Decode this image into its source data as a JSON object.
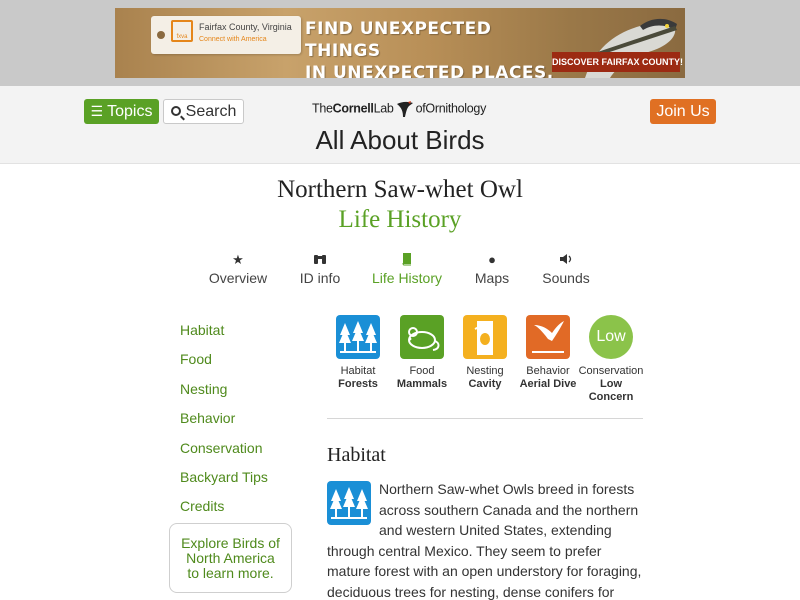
{
  "ad": {
    "tag_title": "Fairfax County, Virginia",
    "tag_subtitle": "Connect with America",
    "headline_1": "FIND UNEXPECTED THINGS",
    "headline_2": "IN UNEXPECTED PLACES.",
    "cta": "DISCOVER FAIRFAX COUNTY!",
    "logo_icon": "fairfax-logo-icon",
    "image_icon": "heron-image"
  },
  "header": {
    "topics_label": "Topics",
    "search_label": "Search",
    "join_label": "Join Us",
    "logo": {
      "the": "The",
      "cornell": "Cornell",
      "lab": "Lab",
      "of": "of",
      "ornithology": "Ornithology"
    },
    "site_title": "All About Birds"
  },
  "species": {
    "name": "Northern Saw-whet Owl",
    "section": "Life History"
  },
  "tabs": [
    {
      "label": "Overview",
      "icon": "star-icon"
    },
    {
      "label": "ID info",
      "icon": "binoculars-icon"
    },
    {
      "label": "Life History",
      "icon": "book-icon",
      "active": true
    },
    {
      "label": "Maps",
      "icon": "globe-icon"
    },
    {
      "label": "Sounds",
      "icon": "speaker-icon"
    }
  ],
  "sidebar": {
    "links": [
      "Habitat",
      "Food",
      "Nesting",
      "Behavior",
      "Conservation",
      "Backyard Tips",
      "Credits"
    ],
    "explore_1": "Explore Birds of",
    "explore_2": "North America",
    "explore_3": "to learn more."
  },
  "cards": [
    {
      "category": "Habitat",
      "value": "Forests",
      "icon": "forest-icon",
      "color": "#1a8fd6"
    },
    {
      "category": "Food",
      "value": "Mammals",
      "icon": "mouse-icon",
      "color": "#5aa125"
    },
    {
      "category": "Nesting",
      "value": "Cavity",
      "icon": "cavity-nest-icon",
      "color": "#f4b01f"
    },
    {
      "category": "Behavior",
      "value": "Aerial Dive",
      "icon": "diving-bird-icon",
      "color": "#e16a26"
    },
    {
      "category": "Conservation",
      "value_1": "Low",
      "value_2": "Concern",
      "badge": "Low",
      "color": "#8bc34a"
    }
  ],
  "habitat": {
    "heading": "Habitat",
    "icon": "forest-icon",
    "text": "Northern Saw-whet Owls breed in forests across southern Canada and the northern and western United States, extending through central Mexico. They seem to prefer mature forest with an open understory for foraging, deciduous trees for nesting, dense conifers for roosting, and"
  },
  "colors": {
    "green": "#5aa125",
    "orange": "#e07023",
    "blue": "#1a8fd6"
  }
}
